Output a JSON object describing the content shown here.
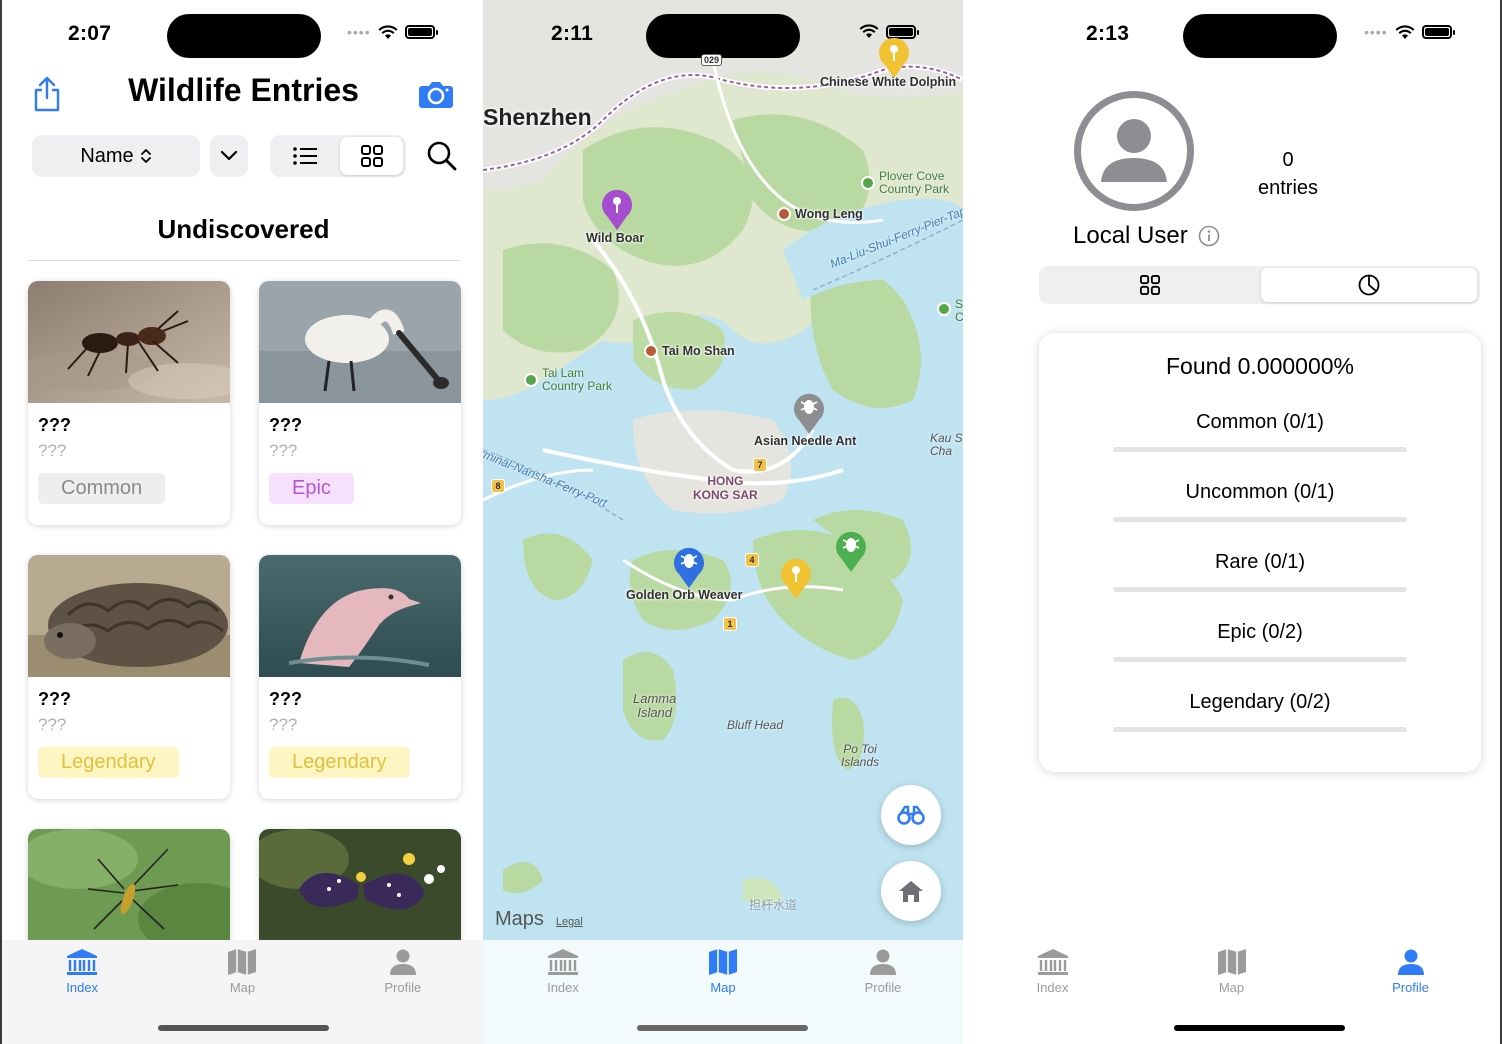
{
  "colors": {
    "accent": "#2f7cf6",
    "common_bg": "#eeeeee",
    "common_fg": "#8a8a8a",
    "epic_bg": "#f7e0fb",
    "epic_fg": "#b357d0",
    "legendary_bg": "#fdf6c2",
    "legendary_fg": "#e0c13d"
  },
  "index_screen": {
    "time": "2:07",
    "title": "Wildlife Entries",
    "sort_label": "Name",
    "section_title": "Undiscovered",
    "cards": [
      {
        "name": "???",
        "scientific": "???",
        "rarity": "Common",
        "photo": "ant-photo"
      },
      {
        "name": "???",
        "scientific": "???",
        "rarity": "Epic",
        "photo": "spoonbill-photo"
      },
      {
        "name": "???",
        "scientific": "???",
        "rarity": "Legendary",
        "photo": "pangolin-photo"
      },
      {
        "name": "???",
        "scientific": "???",
        "rarity": "Legendary",
        "photo": "dolphin-photo"
      },
      {
        "name": "",
        "scientific": "",
        "rarity": "",
        "photo": "spider-photo"
      },
      {
        "name": "",
        "scientific": "",
        "rarity": "",
        "photo": "butterfly-photo"
      }
    ]
  },
  "map_screen": {
    "time": "2:11",
    "labels": {
      "shenzhen": "Shenzhen",
      "chinese_white_dolphin": "Chinese White Dolphin",
      "plover_cove_1": "Plover Cove",
      "plover_cove_2": "Country Park",
      "wild_boar": "Wild Boar",
      "wong_leng": "Wong Leng",
      "ferry_pier": "Ma-Liu-Shui-Ferry-Pier-Tap",
      "tai_mo_shan": "Tai Mo Shan",
      "tai_lam_1": "Tai Lam",
      "tai_lam_2": "Country Park",
      "asian_needle_ant": "Asian Needle Ant",
      "kau_sai_1": "Kau S",
      "kau_sai_2": "Cha",
      "hong_kong_1": "HONG",
      "hong_kong_2": "KONG SAR",
      "nansha_ferry": "rminal-Nansha-Ferry-Port",
      "golden_orb_weaver": "Golden Orb Weaver",
      "lamma_1": "Lamma",
      "lamma_2": "Island",
      "bluff_head": "Bluff Head",
      "po_toi_1": "Po Toi",
      "po_toi_2": "Islands",
      "reservoir": "担杆水道",
      "maps_brand": "Maps",
      "legal": "Legal",
      "sai_kung_1": "S",
      "sai_kung_2": "C",
      "route_029": "029"
    },
    "route_shields": [
      "7",
      "8",
      "4",
      "1"
    ]
  },
  "profile_screen": {
    "time": "2:13",
    "entries_count": "0",
    "entries_label": "entries",
    "username": "Local User",
    "found_title": "Found 0.000000%",
    "rarities": [
      {
        "label": "Common (0/1)",
        "progress": 0
      },
      {
        "label": "Uncommon (0/1)",
        "progress": 0
      },
      {
        "label": "Rare (0/1)",
        "progress": 0
      },
      {
        "label": "Epic (0/2)",
        "progress": 0
      },
      {
        "label": "Legendary (0/2)",
        "progress": 0
      }
    ]
  },
  "tabs": [
    {
      "label": "Index",
      "icon": "bank-icon"
    },
    {
      "label": "Map",
      "icon": "map-icon"
    },
    {
      "label": "Profile",
      "icon": "person-icon"
    }
  ]
}
